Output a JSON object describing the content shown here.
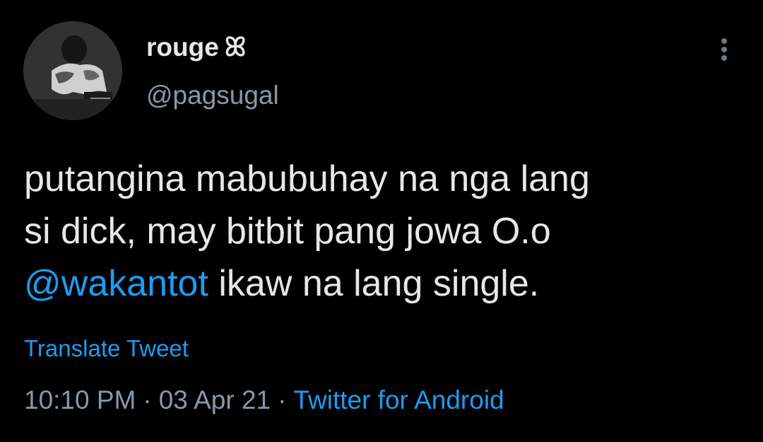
{
  "author": {
    "display_name": "rouge",
    "name_symbol": "ꕤ",
    "handle": "@pagsugal",
    "avatar": "avatar-image"
  },
  "menu": {
    "icon": "more-vertical-icon"
  },
  "tweet": {
    "lines": [
      {
        "text": "putangina mabubuhay na nga lang"
      },
      {
        "text": "si dick, may bitbit pang jowa O.o"
      }
    ],
    "mention": "@wakantot",
    "mention_rest": " ikaw na lang single."
  },
  "translate_label": "Translate Tweet",
  "meta": {
    "time": "10:10 PM",
    "separator": "·",
    "date": "03 Apr 21",
    "source": "Twitter for Android"
  },
  "colors": {
    "background": "#000000",
    "text": "#e7e7e7",
    "secondary": "#8b98a5",
    "accent": "#1d9bf0"
  }
}
